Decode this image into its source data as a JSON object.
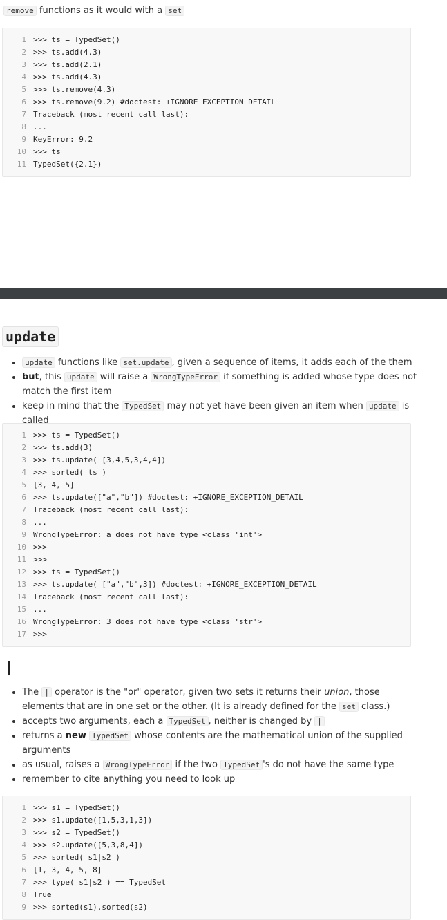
{
  "intro": {
    "code1": "remove",
    "text": " functions as it would with a ",
    "code2": "set"
  },
  "block1": [
    ">>> ts = TypedSet()",
    ">>> ts.add(4.3)",
    ">>> ts.add(2.1)",
    ">>> ts.add(4.3)",
    ">>> ts.remove(4.3)",
    ">>> ts.remove(9.2) #doctest: +IGNORE_EXCEPTION_DETAIL",
    "Traceback (most recent call last):",
    "...",
    "KeyError: 9.2",
    ">>> ts",
    "TypedSet({2.1})"
  ],
  "update_section": {
    "heading": "update",
    "bullets": [
      {
        "c1": "update",
        "t1": " functions like ",
        "c2": "set.update",
        "t2": ", given a sequence of items, it adds each of the them"
      },
      {
        "b": "but",
        "t1": ", this ",
        "c1": "update",
        "t2": " will raise a ",
        "c2": "WrongTypeError",
        "t3": " if something is added whose type does not match the first item"
      },
      {
        "t1": "keep in mind that the ",
        "c1": "TypedSet",
        "t2": " may not yet have been given an item when ",
        "c2": "update",
        "t3": " is called"
      }
    ],
    "code": [
      ">>> ts = TypedSet()",
      ">>> ts.add(3)",
      ">>> ts.update( [3,4,5,3,4,4])",
      ">>> sorted( ts )",
      "[3, 4, 5]",
      ">>> ts.update([\"a\",\"b\"]) #doctest: +IGNORE_EXCEPTION_DETAIL",
      "Traceback (most recent call last):",
      "...",
      "WrongTypeError: a does not have type <class 'int'>",
      ">>>",
      ">>>",
      ">>> ts = TypedSet()",
      ">>> ts.update( [\"a\",\"b\",3]) #doctest: +IGNORE_EXCEPTION_DETAIL",
      "Traceback (most recent call last):",
      "...",
      "WrongTypeError: 3 does not have type <class 'str'>",
      ">>>"
    ]
  },
  "union_section": {
    "heading": "|",
    "bullets": [
      {
        "t1": "The ",
        "c1": "|",
        "t2": " operator is the \"or\" operator, given two sets it returns their ",
        "i": "union",
        "t3": ", those elements that are in one set or the other. (It is already defined for the ",
        "c2": "set",
        "t4": " class.)"
      },
      {
        "t1": "accepts two arguments, each a ",
        "c1": "TypedSet",
        "t2": ", neither is changed by ",
        "c2": "|"
      },
      {
        "t1": "returns a ",
        "b": "new",
        "t2": " ",
        "c1": "TypedSet",
        "t3": " whose contents are the mathematical union of the supplied arguments"
      },
      {
        "t1": "as usual, raises a ",
        "c1": "WrongTypeError",
        "t2": " if the two ",
        "c2": "TypedSet",
        "t3": "'s do not have the same type"
      },
      {
        "t1": "remember to cite anything you need to look up"
      }
    ],
    "code": [
      ">>> s1 = TypedSet()",
      ">>> s1.update([1,5,3,1,3])",
      ">>> s2 = TypedSet()",
      ">>> s2.update([5,3,8,4])",
      ">>> sorted( s1|s2 )",
      "[1, 3, 4, 5, 8]",
      ">>> type( s1|s2 ) == TypedSet",
      "True",
      ">>> sorted(s1),sorted(s2)"
    ]
  }
}
